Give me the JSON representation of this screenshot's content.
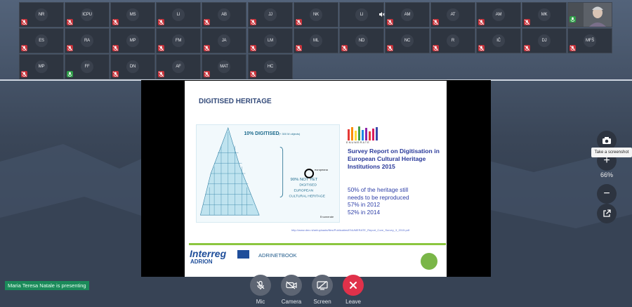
{
  "participants_row1": [
    {
      "initials": "NR",
      "mic": "muted"
    },
    {
      "initials": "ICPU",
      "mic": "muted"
    },
    {
      "initials": "MS",
      "mic": "muted"
    },
    {
      "initials": "LI",
      "mic": "muted"
    },
    {
      "initials": "AB",
      "mic": "muted"
    },
    {
      "initials": "JJ",
      "mic": "muted"
    },
    {
      "initials": "NK",
      "mic": "muted"
    },
    {
      "initials": "LI",
      "mic": "speaker-off"
    },
    {
      "initials": "AM",
      "mic": "muted"
    },
    {
      "initials": "AT",
      "mic": "muted"
    },
    {
      "initials": "AM",
      "mic": "muted"
    },
    {
      "initials": "MK",
      "mic": "muted"
    }
  ],
  "participants_row2": [
    {
      "initials": "ES",
      "mic": "muted"
    },
    {
      "initials": "RA",
      "mic": "muted"
    },
    {
      "initials": "MP",
      "mic": "muted"
    },
    {
      "initials": "FM",
      "mic": "muted"
    },
    {
      "initials": "JA",
      "mic": "muted"
    },
    {
      "initials": "LM",
      "mic": "muted"
    },
    {
      "initials": "ML",
      "mic": "muted"
    },
    {
      "initials": "ND",
      "mic": "muted"
    },
    {
      "initials": "NC",
      "mic": "muted"
    },
    {
      "initials": "R",
      "mic": "muted"
    },
    {
      "initials": "IČ",
      "mic": "muted"
    },
    {
      "initials": "DJ",
      "mic": "muted"
    },
    {
      "initials": "MFŠ",
      "mic": "muted"
    }
  ],
  "participants_row3": [
    {
      "initials": "MP",
      "mic": "muted"
    },
    {
      "initials": "FF",
      "mic": "on"
    },
    {
      "initials": "DN",
      "mic": "muted"
    },
    {
      "initials": "AF",
      "mic": "muted"
    },
    {
      "initials": "MAT",
      "mic": "muted"
    },
    {
      "initials": "HC",
      "mic": "muted"
    }
  ],
  "slide": {
    "title": "DIGITISED HERITAGE",
    "enumerate_word": "ENUMERATE",
    "report_title": "Survey Report on Digitisation in European Cultural Heritage Institutions 2015",
    "stat_lines": [
      "50% of the heritage still",
      "needs to be reproduced",
      "57% in 2012",
      "52% in 2014"
    ],
    "url": "http://www.den.nl/art/uploads/files/Publicaties/ENUMERATE_Report_Core_Survey_3_2015.pdf",
    "interreg": "Interreg",
    "adrion": "ADRION",
    "adrinetbook": "ADRINETBOOK"
  },
  "zoom_label": "66%",
  "tooltip": "Take a screenshot",
  "presenting": "Maria Teresa Natale is presenting",
  "controls": {
    "mic": "Mic",
    "camera": "Camera",
    "screen": "Screen",
    "leave": "Leave"
  },
  "colors": {
    "muted": "#c7323a",
    "mic_on": "#2f9d48",
    "leave": "#e0314a",
    "presenting_bg": "#1b8a5a",
    "slide_title": "#344b7a"
  }
}
